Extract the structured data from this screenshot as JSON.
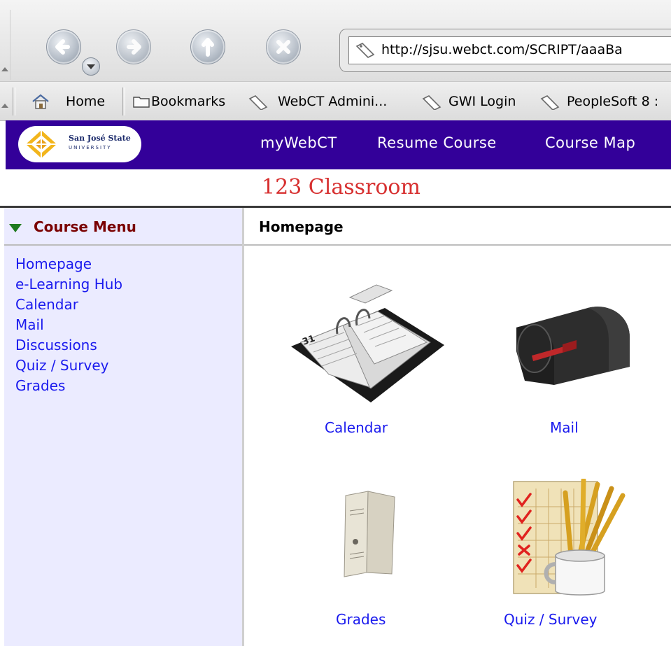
{
  "browser": {
    "url": "http://sjsu.webct.com/SCRIPT/aaaBa",
    "bookmarks": [
      "Home",
      "Bookmarks",
      "WebCT Admini...",
      "GWI Login",
      "PeopleSoft 8 :"
    ]
  },
  "banner": {
    "logo_line1": "San José State",
    "logo_line2": "UNIVERSITY",
    "links": [
      "myWebCT",
      "Resume Course",
      "Course Map"
    ]
  },
  "course_title": "123 Classroom",
  "sidebar": {
    "heading": "Course Menu",
    "items": [
      "Homepage",
      "e-Learning Hub",
      "Calendar",
      "Mail",
      "Discussions",
      "Quiz / Survey",
      "Grades"
    ]
  },
  "main": {
    "heading": "Homepage",
    "tools": [
      {
        "label": "Calendar",
        "icon": "desk-calendar-icon"
      },
      {
        "label": "Mail",
        "icon": "mailbox-icon"
      },
      {
        "label": "Grades",
        "icon": "report-card-icon"
      },
      {
        "label": "Quiz / Survey",
        "icon": "checklist-pencils-icon"
      }
    ]
  },
  "colors": {
    "banner": "#330099",
    "link": "#1a1aee",
    "course_title": "#d73030",
    "menu_heading": "#7a0000",
    "sidebar_bg": "#ebebff"
  }
}
